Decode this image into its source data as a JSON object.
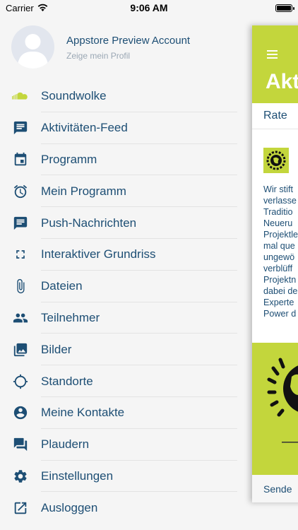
{
  "status_bar": {
    "carrier": "Carrier",
    "time": "9:06 AM"
  },
  "profile": {
    "name": "Appstore Preview Account",
    "subtitle": "Zeige mein Profil"
  },
  "menu": {
    "items": [
      {
        "label": "Soundwolke",
        "icon": "cloud-icon"
      },
      {
        "label": "Aktivitäten-Feed",
        "icon": "feed-icon"
      },
      {
        "label": "Programm",
        "icon": "calendar-icon"
      },
      {
        "label": "Mein Programm",
        "icon": "alarm-icon"
      },
      {
        "label": "Push-Nachrichten",
        "icon": "message-icon"
      },
      {
        "label": "Interaktiver Grundriss",
        "icon": "fullscreen-icon"
      },
      {
        "label": "Dateien",
        "icon": "paperclip-icon"
      },
      {
        "label": "Teilnehmer",
        "icon": "people-icon"
      },
      {
        "label": "Bilder",
        "icon": "photo-icon"
      },
      {
        "label": "Standorte",
        "icon": "location-icon"
      },
      {
        "label": "Meine Kontakte",
        "icon": "contact-icon"
      },
      {
        "label": "Plaudern",
        "icon": "chat-icon"
      },
      {
        "label": "Einstellungen",
        "icon": "settings-icon"
      },
      {
        "label": "Ausloggen",
        "icon": "logout-icon"
      }
    ]
  },
  "content": {
    "title": "Akt",
    "tab": "Rate",
    "body_lines": [
      "Wir stift",
      "verlasse",
      "Traditio",
      "Neueru",
      "Projektle",
      "mal que",
      "ungewö",
      "verblüff",
      "Projektn",
      "dabei de",
      "Experte",
      "Power d"
    ],
    "bottom": "Sende"
  },
  "colors": {
    "accent": "#c3d63c",
    "text": "#1d4e74",
    "icon": "#1d4e74"
  }
}
